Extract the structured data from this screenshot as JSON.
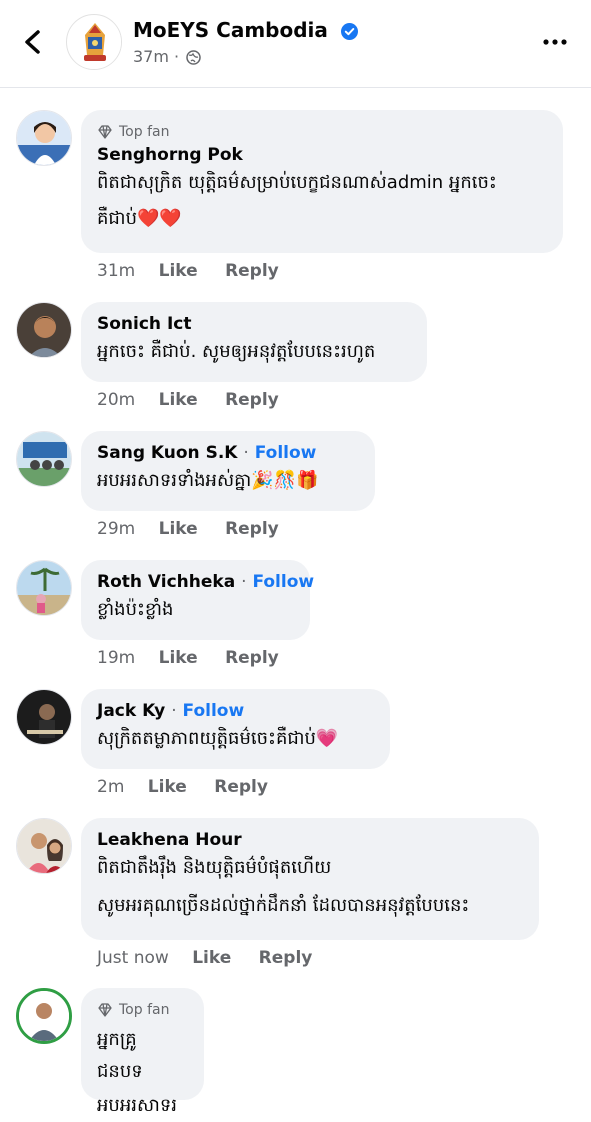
{
  "header": {
    "page_name": "MoEYS Cambodia",
    "time": "37m",
    "separator": "·"
  },
  "actions": {
    "like": "Like",
    "reply": "Reply"
  },
  "comments": [
    {
      "badge": "Top fan",
      "name": "Senghorng Pok",
      "follow": "",
      "line1": "ពិតជាសុក្រិត យុត្តិធម៌សម្រាប់បេក្ខជនណាស់admin អ្នកចេះ",
      "line2": "គឺជាប់❤️❤️",
      "time": "31m"
    },
    {
      "badge": "",
      "name": "Sonich Ict",
      "follow": "",
      "line1": "អ្នកចេះ គឺជាប់. សូមឲ្យអនុវត្តបែបនេះរហូត",
      "line2": "",
      "time": "20m"
    },
    {
      "badge": "",
      "name": "Sang Kuon S.K",
      "follow": "Follow",
      "line1": "អបអរសាទរទាំងអស់គ្នា🎉🎊🎁",
      "line2": "",
      "time": "29m"
    },
    {
      "badge": "",
      "name": "Roth Vichheka",
      "follow": "Follow",
      "line1": "ខ្លាំងប៉ះខ្លាំង",
      "line2": "",
      "time": "19m"
    },
    {
      "badge": "",
      "name": "Jack Ky",
      "follow": "Follow",
      "line1": "សុក្រិតតម្លាភាពយុត្តិធម៌ចេះគឺជាប់💗",
      "line2": "",
      "time": "2m"
    },
    {
      "badge": "",
      "name": "Leakhena Hour",
      "follow": "",
      "line1": "ពិតជាតឹងរ៉ឹង និងយុត្តិធម៌បំផុតហើយ",
      "line2": "សូមអរគុណច្រើនដល់ថ្នាក់ដឹកនាំ ដែលបានអនុវត្តបែបនេះ",
      "time": "Just now"
    },
    {
      "badge": "Top fan",
      "name": "",
      "follow": "",
      "line1": "អ្នកគ្រូ ជនបទ",
      "line2": "អបអរសាទរ",
      "time": ""
    }
  ],
  "colors": {
    "accent": "#1877f2",
    "bubble": "#f0f2f5",
    "secondary_text": "#65676b"
  }
}
